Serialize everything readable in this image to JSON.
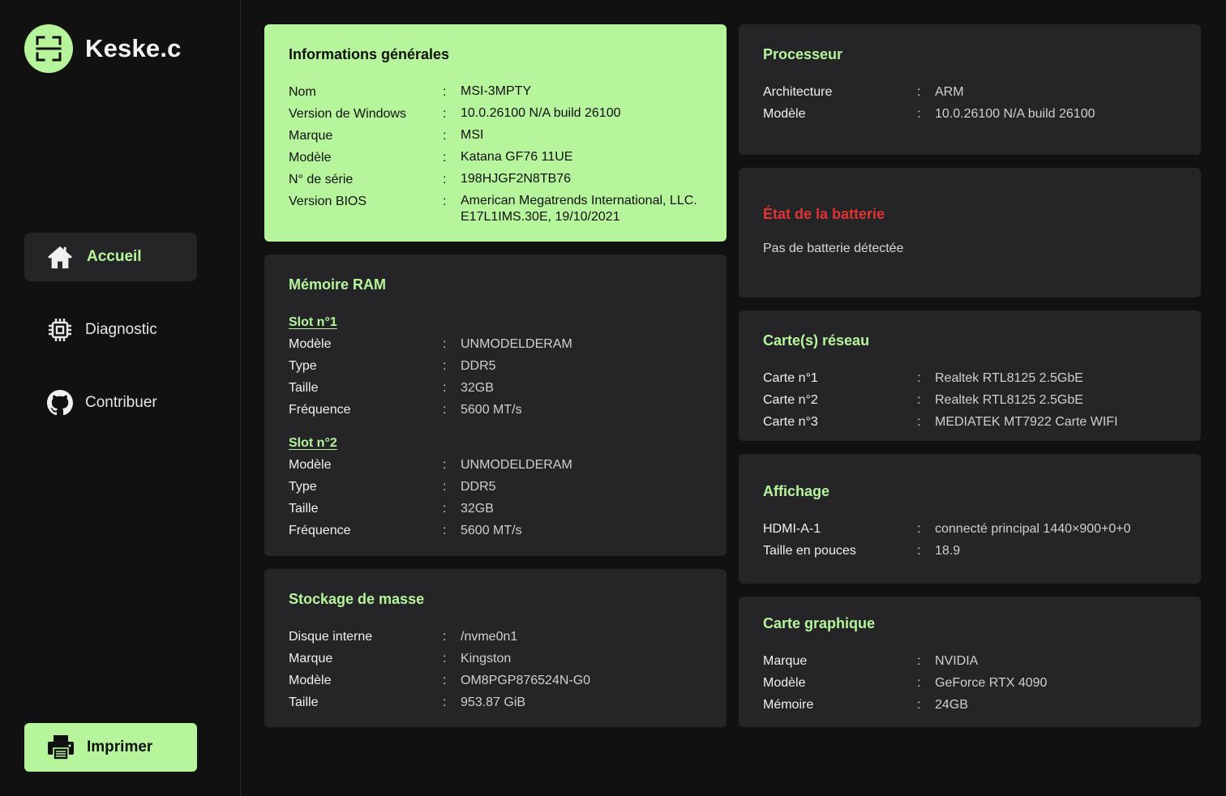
{
  "app": {
    "name": "Keske.c"
  },
  "nav": {
    "items": [
      {
        "label": "Accueil",
        "icon": "home-icon",
        "active": true
      },
      {
        "label": "Diagnostic",
        "icon": "chip-icon",
        "active": false
      },
      {
        "label": "Contribuer",
        "icon": "github-icon",
        "active": false
      }
    ],
    "print_label": "Imprimer"
  },
  "colors": {
    "accent": "#b6f59b",
    "background": "#111112",
    "card": "#252528",
    "warning": "#e03434"
  },
  "general": {
    "title": "Informations générales",
    "rows": [
      {
        "k": "Nom",
        "v": "MSI-3MPTY"
      },
      {
        "k": "Version de Windows",
        "v": "10.0.26100 N/A build 26100"
      },
      {
        "k": "Marque",
        "v": "MSI"
      },
      {
        "k": "Modèle",
        "v": "Katana GF76 11UE"
      },
      {
        "k": "N° de série",
        "v": "198HJGF2N8TB76"
      },
      {
        "k": "Version BIOS",
        "v": "American Megatrends International, LLC. E17L1IMS.30E, 19/10/2021"
      }
    ]
  },
  "ram": {
    "title": "Mémoire RAM",
    "slots": [
      {
        "title": "Slot n°1",
        "rows": [
          {
            "k": "Modèle",
            "v": "UNMODELDERAM"
          },
          {
            "k": "Type",
            "v": "DDR5"
          },
          {
            "k": "Taille",
            "v": "32GB"
          },
          {
            "k": "Fréquence",
            "v": "5600 MT/s"
          }
        ]
      },
      {
        "title": "Slot n°2",
        "rows": [
          {
            "k": "Modèle",
            "v": "UNMODELDERAM"
          },
          {
            "k": "Type",
            "v": "DDR5"
          },
          {
            "k": "Taille",
            "v": "32GB"
          },
          {
            "k": "Fréquence",
            "v": "5600 MT/s"
          }
        ]
      }
    ]
  },
  "storage": {
    "title": "Stockage de masse",
    "rows": [
      {
        "k": "Disque interne",
        "v": "/nvme0n1"
      },
      {
        "k": "Marque",
        "v": "Kingston"
      },
      {
        "k": "Modèle",
        "v": "OM8PGP876524N-G0"
      },
      {
        "k": "Taille",
        "v": "953.87 GiB"
      }
    ]
  },
  "cpu": {
    "title": "Processeur",
    "rows": [
      {
        "k": "Architecture",
        "v": "ARM"
      },
      {
        "k": "Modèle",
        "v": "10.0.26100 N/A build 26100"
      }
    ]
  },
  "battery": {
    "title": "État de la batterie",
    "text": "Pas de batterie détectée"
  },
  "network": {
    "title": "Carte(s) réseau",
    "rows": [
      {
        "k": "Carte n°1",
        "v": "Realtek RTL8125 2.5GbE"
      },
      {
        "k": "Carte n°2",
        "v": "Realtek RTL8125 2.5GbE"
      },
      {
        "k": "Carte n°3",
        "v": "MEDIATEK MT7922 Carte WIFI"
      }
    ]
  },
  "display": {
    "title": "Affichage",
    "rows": [
      {
        "k": "HDMI-A-1",
        "v": "connecté principal 1440×900+0+0"
      },
      {
        "k": "Taille en pouces",
        "v": "18.9"
      }
    ]
  },
  "gpu": {
    "title": "Carte graphique",
    "rows": [
      {
        "k": "Marque",
        "v": "NVIDIA"
      },
      {
        "k": "Modèle",
        "v": "GeForce RTX 4090"
      },
      {
        "k": "Mémoire",
        "v": "24GB"
      }
    ]
  }
}
